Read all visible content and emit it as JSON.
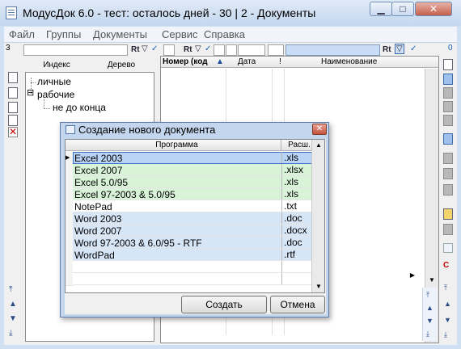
{
  "window": {
    "title": "МодусДок 6.0 - тест: осталось дней - 30 | 2 - Документы",
    "min_label": "▁",
    "max_label": "□",
    "close_label": "✕"
  },
  "menu": [
    "Файл",
    "Группы",
    "Документы",
    "Сервис",
    "Справка"
  ],
  "left_filter": {
    "count": "3",
    "rt_label": "Rt"
  },
  "right_filter": {
    "count": "0",
    "rt_label": "Rt"
  },
  "tree_panel": {
    "tab_index": "Индекс",
    "tab_tree": "Дерево",
    "nodes": [
      {
        "label": "личные",
        "level": 0
      },
      {
        "label": "рабочие",
        "level": 0,
        "expander": "⊟"
      },
      {
        "label": "не до конца",
        "level": 1
      }
    ]
  },
  "doc_list": {
    "columns": [
      "Номер (код",
      "Дата",
      "!",
      "Наименование"
    ],
    "sort_indicator": "▲"
  },
  "dialog": {
    "title": "Создание нового документа",
    "columns": [
      "Программа",
      "Расш."
    ],
    "rows": [
      {
        "program": "Excel 2003",
        "ext": ".xls",
        "group": "excel",
        "selected": true
      },
      {
        "program": "Excel 2007",
        "ext": ".xlsx",
        "group": "excel"
      },
      {
        "program": "Excel 5.0/95",
        "ext": ".xls",
        "group": "excel"
      },
      {
        "program": "Excel 97-2003 & 5.0/95",
        "ext": ".xls",
        "group": "excel"
      },
      {
        "program": "NotePad",
        "ext": ".txt",
        "group": "plain"
      },
      {
        "program": "Word 2003",
        "ext": ".doc",
        "group": "word"
      },
      {
        "program": "Word 2007",
        "ext": ".docx",
        "group": "word"
      },
      {
        "program": "Word 97-2003 & 6.0/95 - RTF",
        "ext": ".doc",
        "group": "word"
      },
      {
        "program": "WordPad",
        "ext": ".rtf",
        "group": "word"
      }
    ],
    "create_label": "Создать",
    "cancel_label": "Отмена"
  },
  "colors": {
    "excel_row": "#d8f3d8",
    "word_row": "#d7e6f7",
    "plain_row": "#ffffff",
    "selected_row": "#b9d4f4",
    "selected_border": "#3b6fc0"
  },
  "icons": [
    "app-icon",
    "filter-icon",
    "check-icon",
    "document-icon",
    "delete-icon",
    "scroll-up-icon",
    "scroll-down-icon",
    "close-icon",
    "row-pointer-icon"
  ]
}
